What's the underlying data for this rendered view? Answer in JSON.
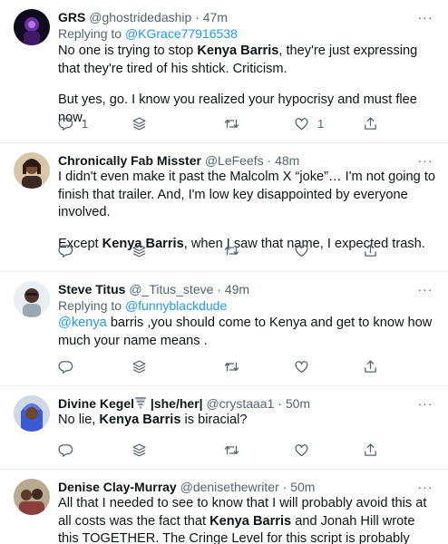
{
  "tweets": [
    {
      "name": "GRS",
      "handle": "@ghostridedaship",
      "time": "· 47m",
      "replying_label": "Replying to ",
      "replying_handle": "@KGrace77916538",
      "p1_a": "No one is trying to stop ",
      "p1_bold": "Kenya Barris",
      "p1_b": ", they're just expressing that they're tired of his shtick. Criticism.",
      "p2": "But yes, go. I know you realized your hypocrisy and must flee now.",
      "reply_count": "1",
      "like_count": "1"
    },
    {
      "name": "Chronically Fab Misster",
      "handle": "@LeFeefs",
      "time": "· 48m",
      "p1": "I didn't even make it past the Malcolm X “joke”… I'm not going to finish that trailer. And, I'm low key disappointed by everyone involved.",
      "p2_a": "Except ",
      "p2_bold": "Kenya Barris",
      "p2_b": ", when I saw that name, I expected trash."
    },
    {
      "name": "Steve Titus",
      "handle": "@_Titus_steve",
      "time": "· 49m",
      "replying_label": "Replying to ",
      "replying_handle": "@funnyblackdude",
      "p1_link": "@kenya",
      "p1_rest": " barris ,you should come to Kenya and get to know how much your name means ."
    },
    {
      "name": "Divine Kegel",
      "name_suffix": " |she/her|",
      "handle": "@crystaaa1",
      "time": "· 50m",
      "p1_a": "No lie, ",
      "p1_bold": "Kenya Barris",
      "p1_b": " is biracial?"
    },
    {
      "name": "Denise Clay-Murray",
      "handle": "@denisethewriter",
      "time": "· 50m",
      "p1_a": "All that I needed to see to know that I will probably avoid this at all costs was the fact that ",
      "p1_bold": "Kenya Barris",
      "p1_b": " and Jonah Hill wrote this TOGETHER. The Cringe Level for this script is probably eleventybillion…"
    }
  ],
  "more_glyph": "···",
  "colors": {
    "text": "#0f1419",
    "secondary": "#536471",
    "link": "#1d9bf0",
    "divider": "#e6ecf0"
  },
  "icons": [
    "reply-icon",
    "thread-stack-icon",
    "retweet-icon",
    "like-icon",
    "share-icon",
    "more-icon",
    "tornado-emoji-icon"
  ]
}
